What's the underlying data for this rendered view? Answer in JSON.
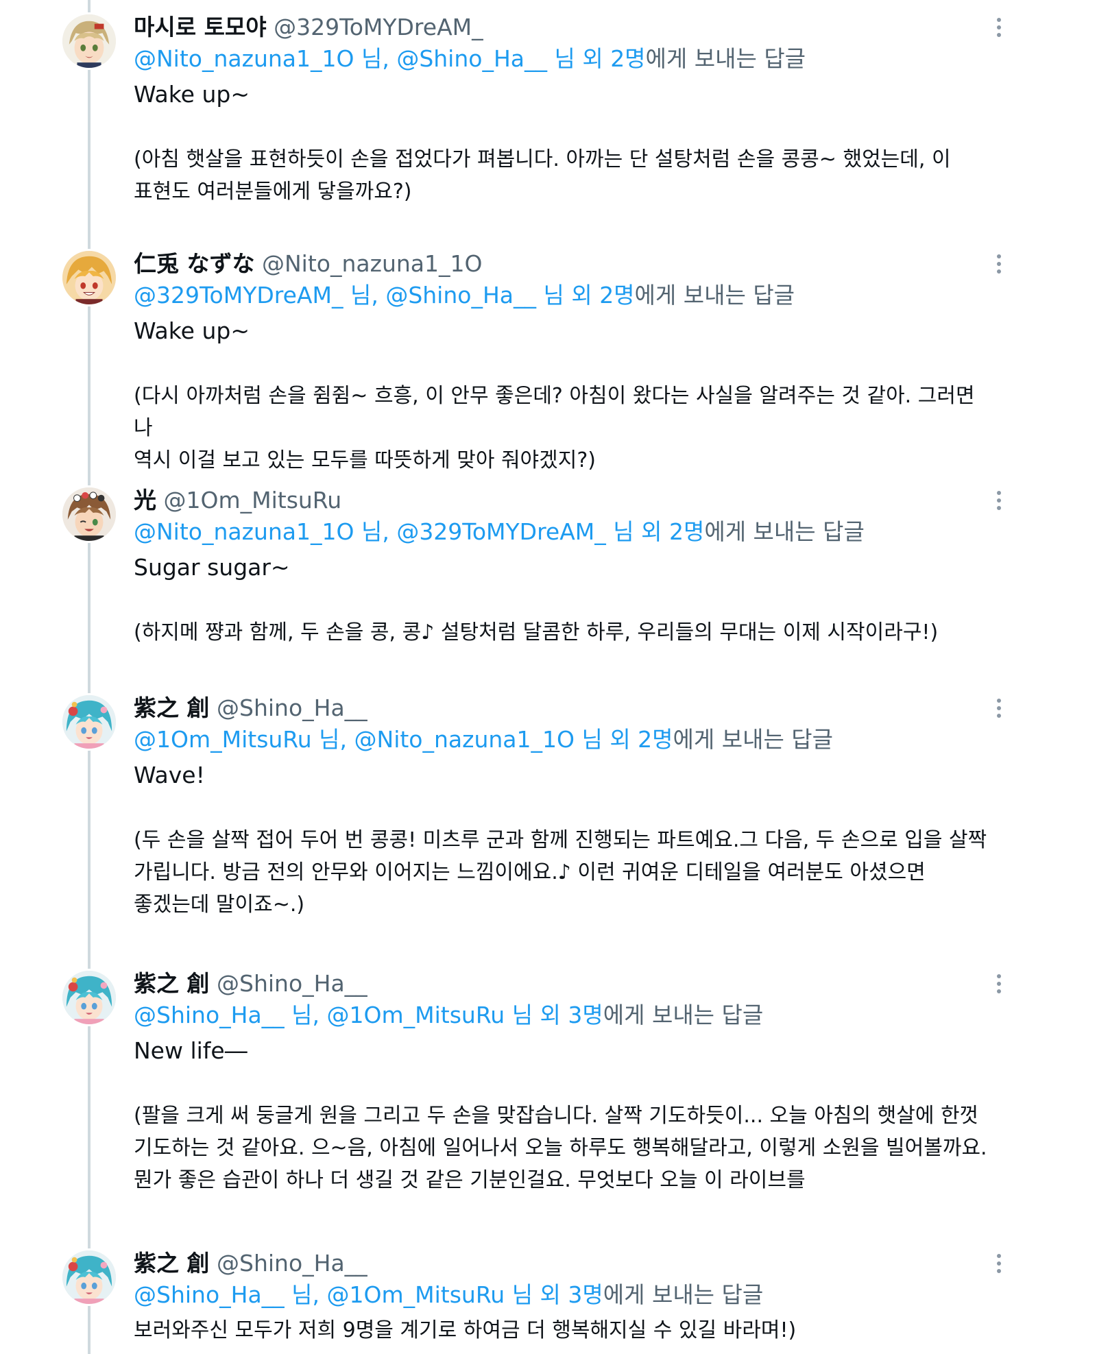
{
  "tweets": [
    {
      "display_name": "마시로 토모야",
      "handle": "@329ToMYDreAM_",
      "mention1": "@Nito_nazuna1_1O",
      "sep1": " 님, ",
      "mention2": "@Shino_Ha__",
      "tail_blue": " 님 외 2명",
      "tail": "에게 보내는 답글",
      "line1": "Wake up~",
      "line2": "(아침 햇살을 표현하듯이 손을 접었다가 펴봅니다. 아까는 단 설탕처럼 손을 콩콩~ 했었는데, 이",
      "line3": "표현도 여러분들에게 닿을까요?)",
      "avatar": "avatar-tomoya"
    },
    {
      "display_name": "仁兎 なずな",
      "handle": "@Nito_nazuna1_1O",
      "mention1": "@329ToMYDreAM_",
      "sep1": " 님, ",
      "mention2": "@Shino_Ha__",
      "tail_blue": " 님 외 2명",
      "tail": "에게 보내는 답글",
      "line1": "Wake up~",
      "line2": "(다시 아까처럼 손을 쥠쥠~ 흐흥, 이 안무 좋은데? 아침이 왔다는 사실을 알려주는 것 같아. 그러면 나",
      "line3": "역시 이걸 보고 있는 모두를 따뜻하게 맞아 줘야겠지?)",
      "avatar": "avatar-nazuna"
    },
    {
      "display_name": "光",
      "handle": "@1Om_MitsuRu",
      "mention1": "@Nito_nazuna1_1O",
      "sep1": " 님, ",
      "mention2": "@329ToMYDreAM_",
      "tail_blue": " 님 외 2명",
      "tail": "에게 보내는 답글",
      "line1": "Sugar sugar~",
      "line2": "(하지메 쨩과 함께, 두 손을 콩, 콩♪ 설탕처럼 달콤한 하루, 우리들의 무대는 이제 시작이라구!)",
      "avatar": "avatar-mitsuru"
    },
    {
      "display_name": "紫之 創",
      "handle": "@Shino_Ha__",
      "mention1": "@1Om_MitsuRu",
      "sep1": " 님, ",
      "mention2": "@Nito_nazuna1_1O",
      "tail_blue": " 님 외 2명",
      "tail": "에게 보내는 답글",
      "line1": "Wave!",
      "line2": "(두 손을 살짝 접어 두어 번 콩콩! 미츠루 군과 함께 진행되는 파트예요.그 다음, 두 손으로 입을 살짝",
      "line3": "가립니다. 방금 전의 안무와 이어지는 느낌이에요.♪ 이런 귀여운 디테일을 여러분도 아셨으면",
      "line4": "좋겠는데 말이죠~.)",
      "avatar": "avatar-hajime"
    },
    {
      "display_name": "紫之 創",
      "handle": "@Shino_Ha__",
      "mention1": "@Shino_Ha__",
      "sep1": " 님, ",
      "mention2": "@1Om_MitsuRu",
      "tail_blue": " 님 외 3명",
      "tail": "에게 보내는 답글",
      "line1": "New life―",
      "line2": "(팔을 크게 써 둥글게 원을 그리고 두 손을 맞잡습니다. 살짝 기도하듯이... 오늘 아침의 햇살에 한껏",
      "line3": "기도하는 것 같아요. 으~음, 아침에 일어나서 오늘 하루도 행복해달라고, 이렇게 소원을 빌어볼까요.",
      "line4": "뭔가 좋은 습관이 하나 더 생길 것 같은 기분인걸요. 무엇보다 오늘 이 라이브를",
      "avatar": "avatar-hajime"
    },
    {
      "display_name": "紫之 創",
      "handle": "@Shino_Ha__",
      "mention1": "@Shino_Ha__",
      "sep1": " 님, ",
      "mention2": "@1Om_MitsuRu",
      "tail_blue": " 님 외 3명",
      "tail": "에게 보내는 답글",
      "line1": "보러와주신 모두가 저희 9명을 계기로 하여금 더 행복해지실 수 있길 바라며!)",
      "avatar": "avatar-hajime"
    }
  ],
  "colors": {
    "link": "#1d9bf0",
    "muted": "#536471",
    "text": "#0f1419",
    "thread_line": "#cfd9de"
  },
  "icons": {
    "more": "more-vertical-icon"
  }
}
